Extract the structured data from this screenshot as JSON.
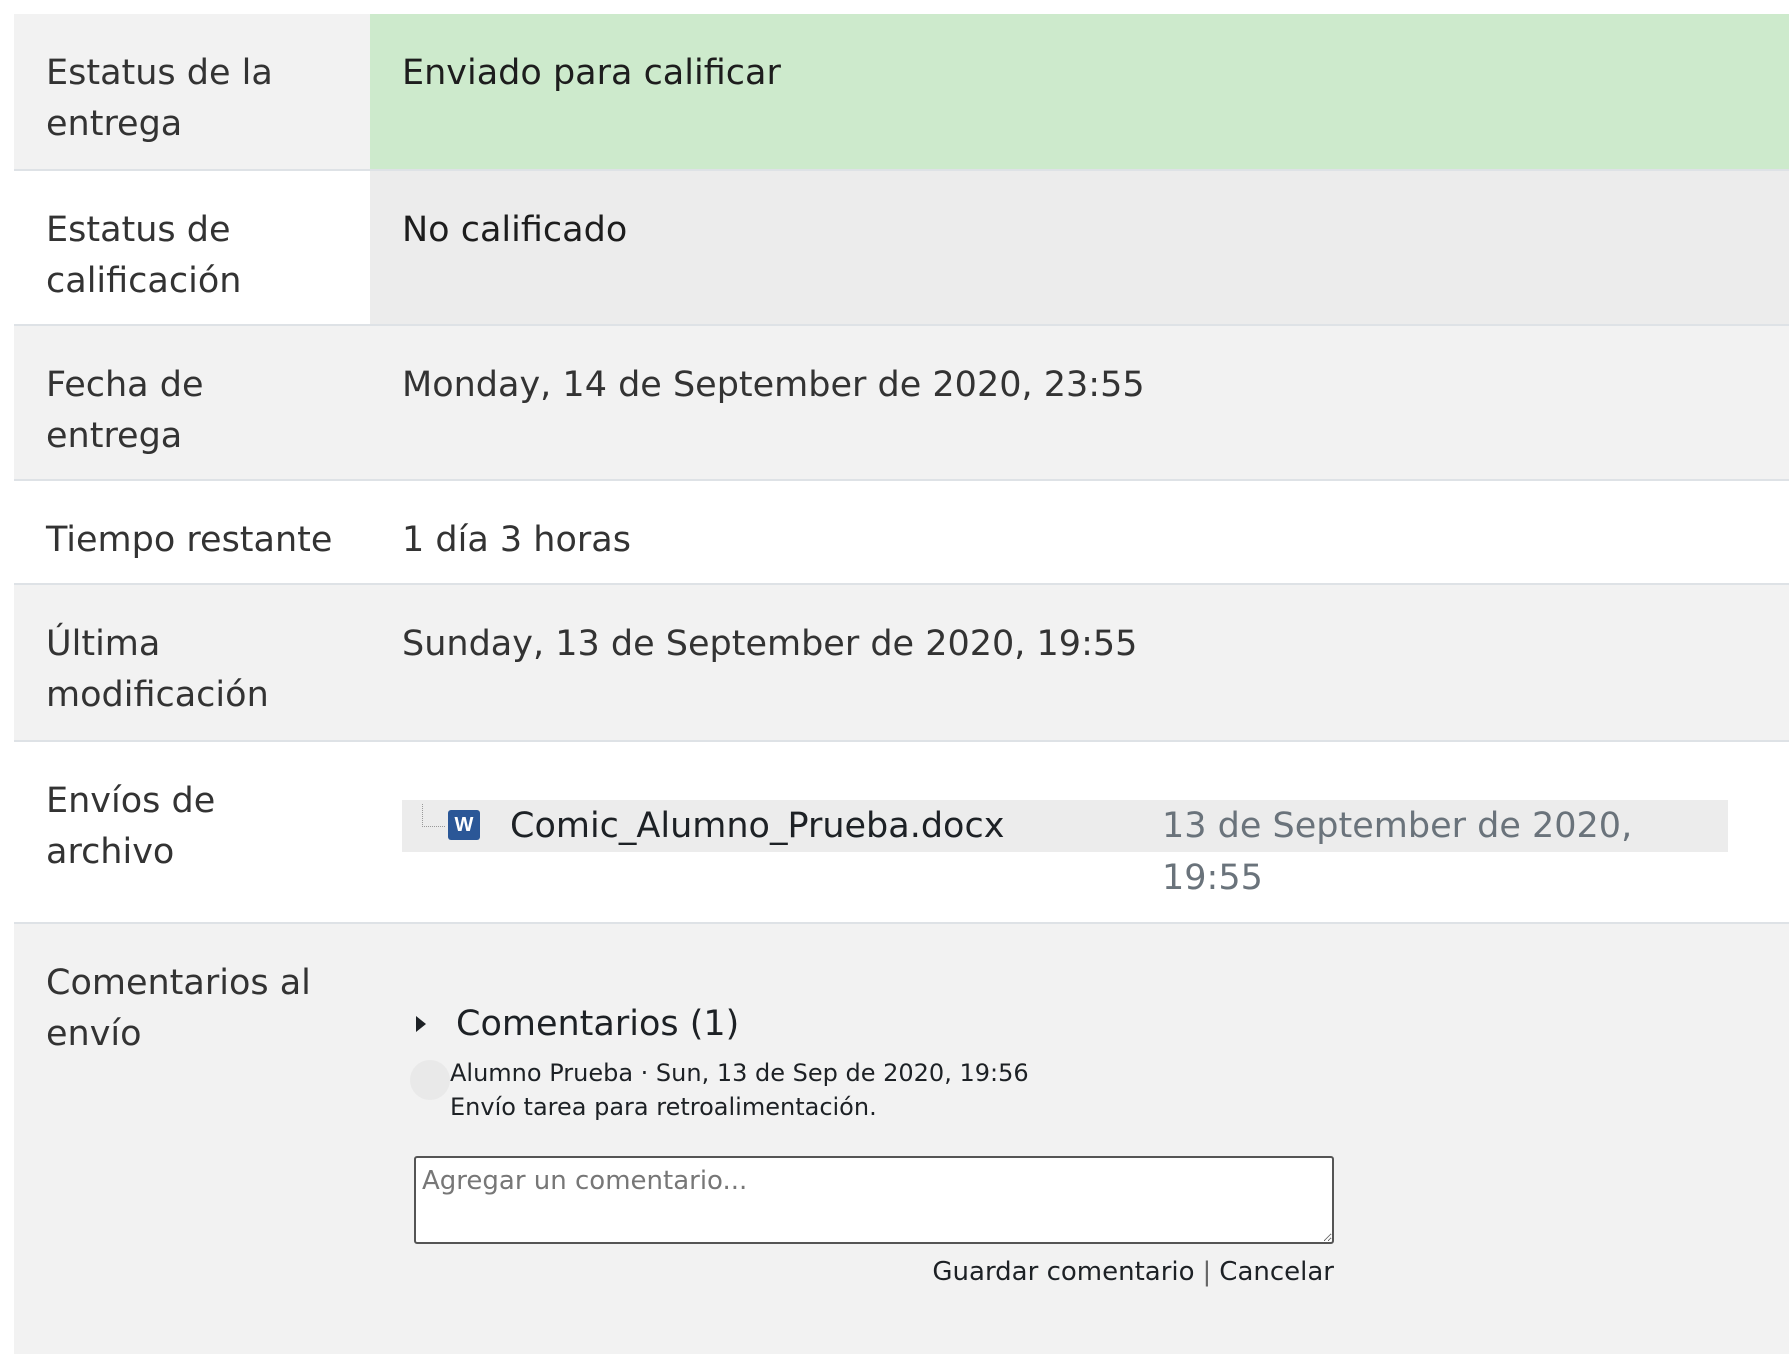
{
  "rows": [
    {
      "label": "Estatus de la entrega",
      "value": "Enviado para calificar"
    },
    {
      "label": "Estatus de calificación",
      "value": "No calificado"
    },
    {
      "label": "Fecha de entrega",
      "value": "Monday, 14 de September de 2020, 23:55"
    },
    {
      "label": "Tiempo restante",
      "value": "1 día 3 horas"
    },
    {
      "label": "Última modificación",
      "value": "Sunday, 13 de September de 2020, 19:55"
    },
    {
      "label": "Envíos de archivo"
    },
    {
      "label": "Comentarios al envío"
    }
  ],
  "file": {
    "name": "Comic_Alumno_Prueba.docx",
    "date": "13 de September de 2020, 19:55",
    "icon": "word-document-icon",
    "icon_letter": "W"
  },
  "comments": {
    "toggle_label": "Comentarios (1)",
    "items": [
      {
        "meta": "Alumno Prueba · Sun, 13 de Sep de 2020, 19:56",
        "text": "Envío tarea para retroalimentación."
      }
    ],
    "input_placeholder": "Agregar un comentario...",
    "save_label": "Guardar comentario",
    "separator": "|",
    "cancel_label": "Cancelar"
  },
  "colors": {
    "submitted_bg": "#cdeacc",
    "not_graded_bg": "#ececec",
    "row_alt_bg": "#f2f2f2"
  }
}
